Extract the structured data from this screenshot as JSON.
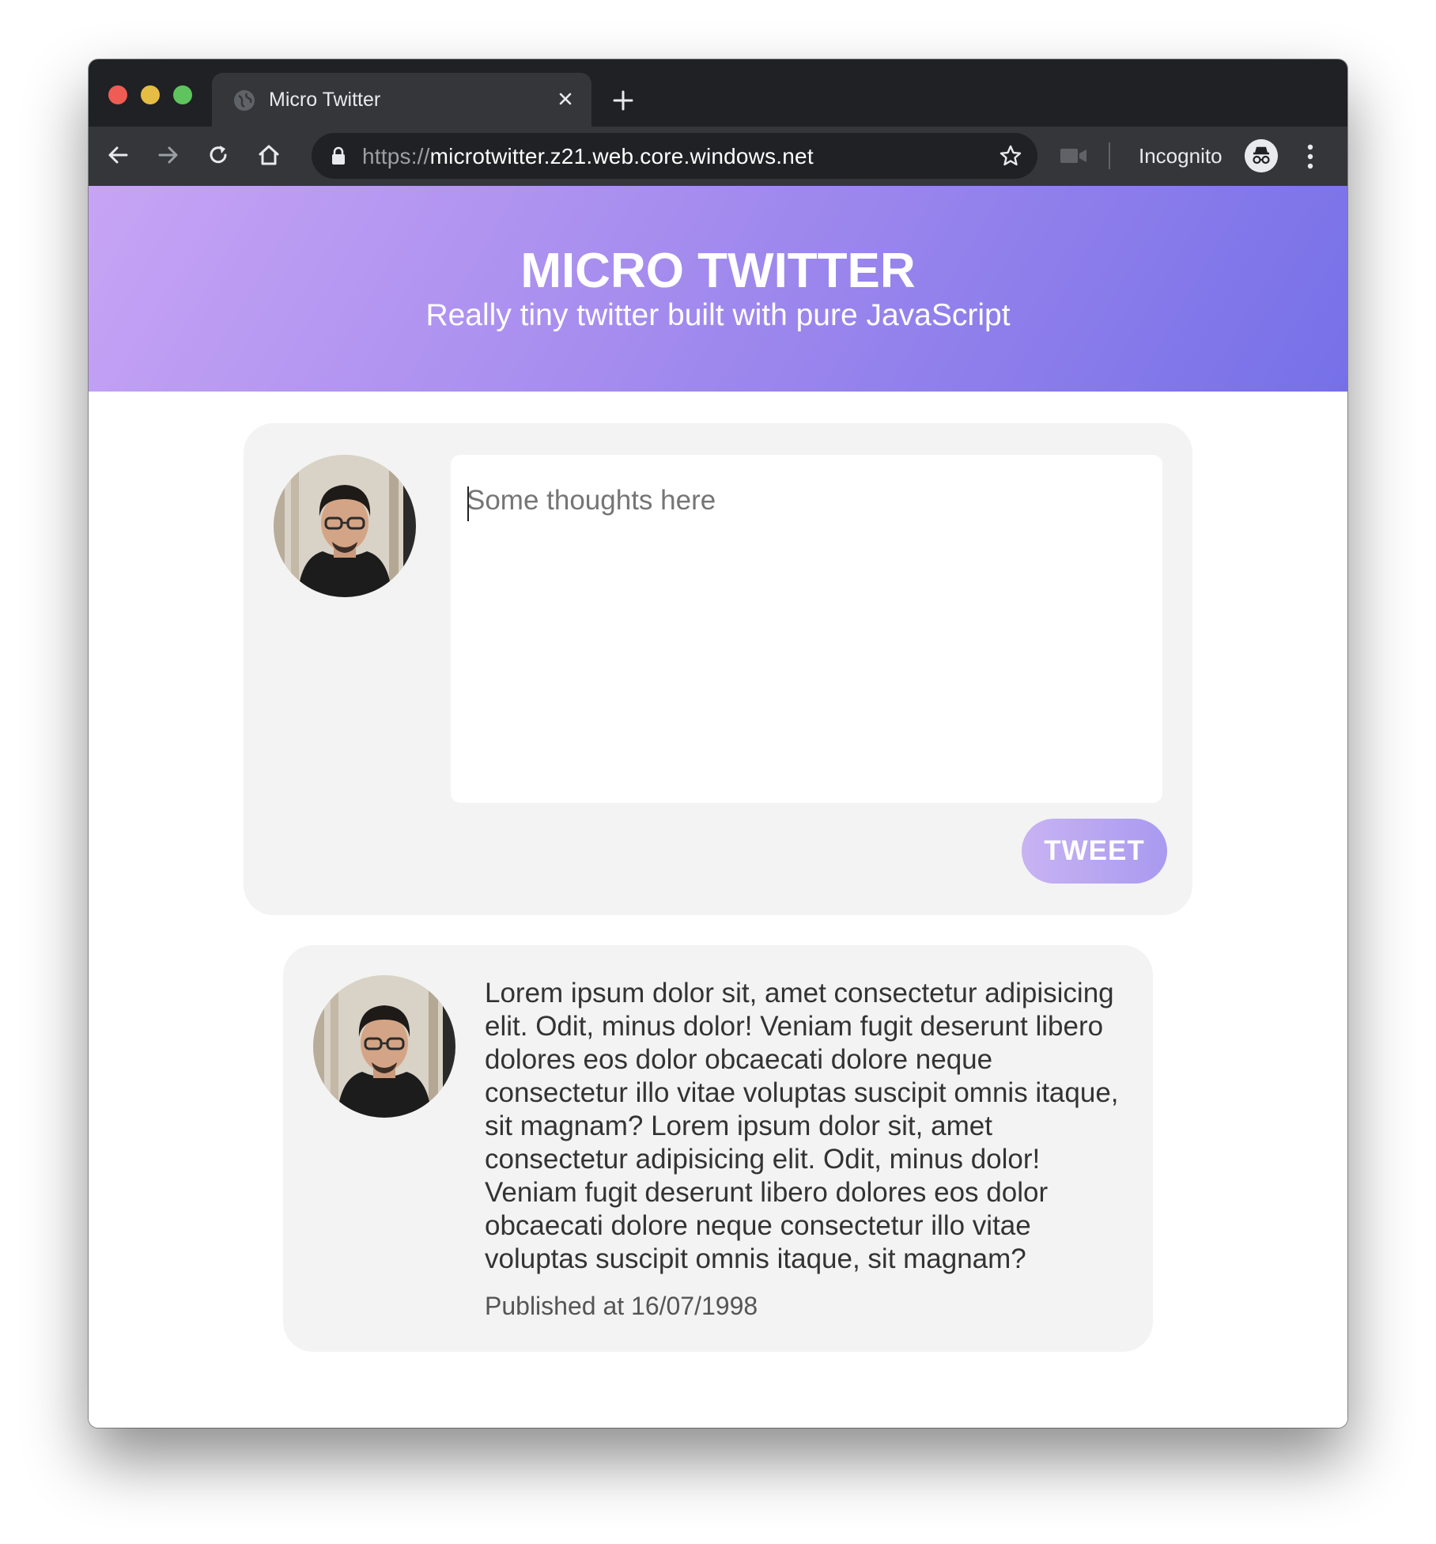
{
  "browser": {
    "tab_title": "Micro Twitter",
    "url_scheme": "https://",
    "url_host": "microtwitter.z21.web.core.windows.net",
    "incognito_label": "Incognito",
    "icons": {
      "back": "arrow-left-icon",
      "forward": "arrow-right-icon",
      "reload": "reload-icon",
      "home": "home-icon",
      "lock": "lock-icon",
      "bookmark": "star-icon",
      "camera": "camera-icon",
      "incognito": "incognito-icon",
      "menu": "kebab-menu-icon",
      "new_tab": "plus-icon",
      "close_tab": "close-icon",
      "favicon": "globe-icon"
    }
  },
  "header": {
    "title": "MICRO TWITTER",
    "subtitle": "Really tiny twitter built with pure JavaScript",
    "gradient_start": "#c7a4f5",
    "gradient_end": "#7670e8"
  },
  "compose": {
    "placeholder": "Some thoughts here",
    "button_label": "TWEET"
  },
  "tweets": [
    {
      "text": "Lorem ipsum dolor sit, amet consectetur adipisicing elit. Odit, minus dolor! Veniam fugit deserunt libero dolores eos dolor obcaecati dolore neque consectetur illo vitae voluptas suscipit omnis itaque, sit magnam? Lorem ipsum dolor sit, amet consectetur adipisicing elit. Odit, minus dolor! Veniam fugit deserunt libero dolores eos dolor obcaecati dolore neque consectetur illo vitae voluptas suscipit omnis itaque, sit magnam?",
      "published": "Published at 16/07/1998"
    }
  ]
}
